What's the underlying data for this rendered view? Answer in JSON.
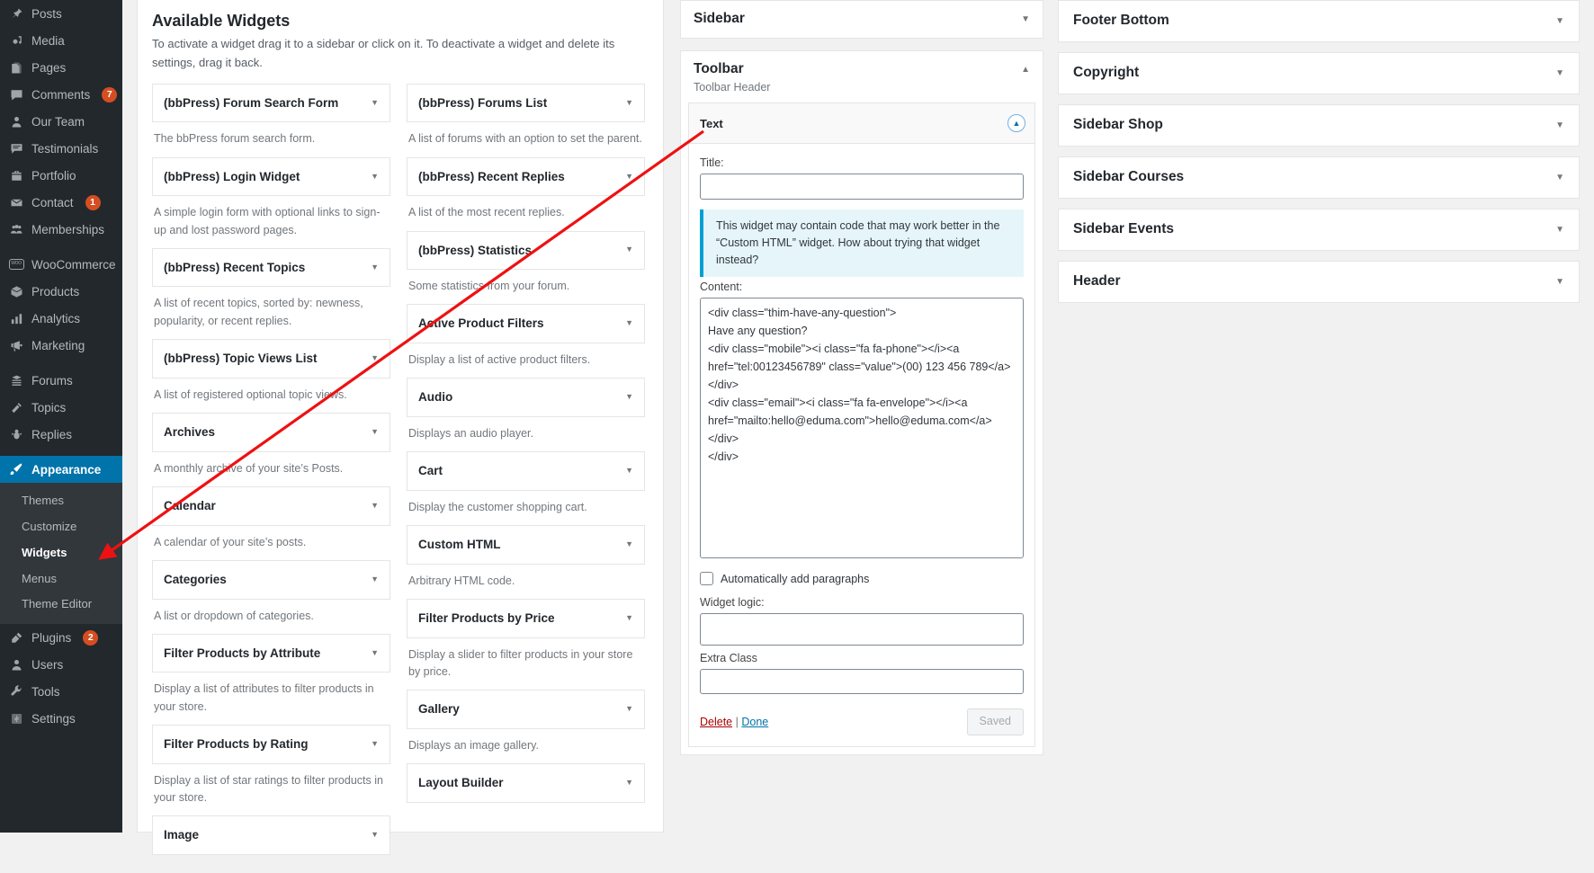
{
  "admin_menu": {
    "items": [
      {
        "label": "Posts",
        "icon": "pin-icon",
        "badge": null
      },
      {
        "label": "Media",
        "icon": "media-icon",
        "badge": null
      },
      {
        "label": "Pages",
        "icon": "pages-icon",
        "badge": null
      },
      {
        "label": "Comments",
        "icon": "comment-icon",
        "badge": "7"
      },
      {
        "label": "Our Team",
        "icon": "user-icon",
        "badge": null
      },
      {
        "label": "Testimonials",
        "icon": "testimonial-icon",
        "badge": null
      },
      {
        "label": "Portfolio",
        "icon": "portfolio-icon",
        "badge": null
      },
      {
        "label": "Contact",
        "icon": "envelope-icon",
        "badge": "1"
      },
      {
        "label": "Memberships",
        "icon": "group-icon",
        "badge": null
      }
    ],
    "items2": [
      {
        "label": "WooCommerce",
        "icon": "woo-icon",
        "badge": null
      },
      {
        "label": "Products",
        "icon": "box-icon",
        "badge": null
      },
      {
        "label": "Analytics",
        "icon": "chart-icon",
        "badge": null
      },
      {
        "label": "Marketing",
        "icon": "megaphone-icon",
        "badge": null
      }
    ],
    "items3": [
      {
        "label": "Forums",
        "icon": "forums-icon",
        "badge": null
      },
      {
        "label": "Topics",
        "icon": "topics-icon",
        "badge": null
      },
      {
        "label": "Replies",
        "icon": "replies-icon",
        "badge": null
      }
    ],
    "appearance": {
      "label": "Appearance",
      "icon": "appearance-brush-icon",
      "active": true
    },
    "appearance_submenu": [
      {
        "label": "Themes",
        "current": false
      },
      {
        "label": "Customize",
        "current": false
      },
      {
        "label": "Widgets",
        "current": true
      },
      {
        "label": "Menus",
        "current": false
      },
      {
        "label": "Theme Editor",
        "current": false
      }
    ],
    "items4": [
      {
        "label": "Plugins",
        "icon": "plug-icon",
        "badge": "2"
      },
      {
        "label": "Users",
        "icon": "users-icon",
        "badge": null
      },
      {
        "label": "Tools",
        "icon": "wrench-icon",
        "badge": null
      },
      {
        "label": "Settings",
        "icon": "settings-icon",
        "badge": null
      }
    ],
    "colors": {
      "background": "#23282d",
      "active": "#0073aa",
      "badge": "#d54e21",
      "submenu_bg": "#32373c"
    }
  },
  "available_widgets": {
    "title": "Available Widgets",
    "intro": "To activate a widget drag it to a sidebar or click on it. To deactivate a widget and delete its settings, drag it back.",
    "left_column": [
      {
        "name": "(bbPress) Forum Search Form",
        "desc": "The bbPress forum search form."
      },
      {
        "name": "(bbPress) Login Widget",
        "desc": "A simple login form with optional links to sign-up and lost password pages."
      },
      {
        "name": "(bbPress) Recent Topics",
        "desc": "A list of recent topics, sorted by: newness, popularity, or recent replies."
      },
      {
        "name": "(bbPress) Topic Views List",
        "desc": "A list of registered optional topic views."
      },
      {
        "name": "Archives",
        "desc": "A monthly archive of your site’s Posts."
      },
      {
        "name": "Calendar",
        "desc": "A calendar of your site’s posts."
      },
      {
        "name": "Categories",
        "desc": "A list or dropdown of categories."
      },
      {
        "name": "Filter Products by Attribute",
        "desc": "Display a list of attributes to filter products in your store."
      },
      {
        "name": "Filter Products by Rating",
        "desc": "Display a list of star ratings to filter products in your store."
      },
      {
        "name": "Image",
        "desc": ""
      }
    ],
    "right_column": [
      {
        "name": "(bbPress) Forums List",
        "desc": "A list of forums with an option to set the parent."
      },
      {
        "name": "(bbPress) Recent Replies",
        "desc": "A list of the most recent replies."
      },
      {
        "name": "(bbPress) Statistics",
        "desc": "Some statistics from your forum."
      },
      {
        "name": "Active Product Filters",
        "desc": "Display a list of active product filters."
      },
      {
        "name": "Audio",
        "desc": "Displays an audio player."
      },
      {
        "name": "Cart",
        "desc": "Display the customer shopping cart."
      },
      {
        "name": "Custom HTML",
        "desc": "Arbitrary HTML code."
      },
      {
        "name": "Filter Products by Price",
        "desc": "Display a slider to filter products in your store by price."
      },
      {
        "name": "Gallery",
        "desc": "Displays an image gallery."
      },
      {
        "name": "Layout Builder",
        "desc": ""
      }
    ],
    "caret": "▼"
  },
  "middle": {
    "sidebar_panel": {
      "title": "Sidebar",
      "toggle": "▼"
    },
    "toolbar_panel": {
      "title": "Toolbar",
      "description": "Toolbar Header",
      "toggle": "▲",
      "widget": {
        "name": "Text",
        "toggle": "▲",
        "title_label": "Title:",
        "title_value": "",
        "notice": "This widget may contain code that may work better in the “Custom HTML” widget. How about trying that widget instead?",
        "content_label": "Content:",
        "content_value": "<div class=\"thim-have-any-question\">\nHave any question?\n<div class=\"mobile\"><i class=\"fa fa-phone\"></i><a href=\"tel:00123456789\" class=\"value\">(00) 123 456 789</a>\n</div>\n<div class=\"email\"><i class=\"fa fa-envelope\"></i><a href=\"mailto:hello@eduma.com\">hello@eduma.com</a>\n</div>\n</div>",
        "auto_paragraphs_label": "Automatically add paragraphs",
        "auto_paragraphs_checked": false,
        "widget_logic_label": "Widget logic:",
        "widget_logic_value": "",
        "extra_class_label": "Extra Class",
        "extra_class_value": "",
        "delete_label": "Delete",
        "separator": "|",
        "done_label": "Done",
        "saved_label": "Saved"
      }
    }
  },
  "right_areas": {
    "toggle": "▼",
    "items": [
      {
        "title": "Footer Bottom"
      },
      {
        "title": "Copyright"
      },
      {
        "title": "Sidebar Shop"
      },
      {
        "title": "Sidebar Courses"
      },
      {
        "title": "Sidebar Events"
      },
      {
        "title": "Header"
      }
    ]
  },
  "annotation": {
    "color": "#ee1111",
    "type": "arrow"
  }
}
